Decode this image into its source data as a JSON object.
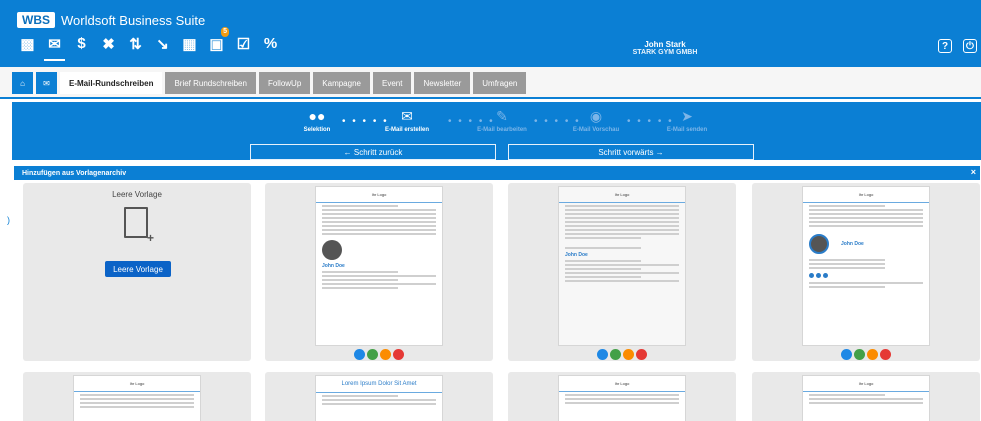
{
  "header": {
    "logo_box": "WBS",
    "logo_text": "Worldsoft Business Suite",
    "user_name": "John Stark",
    "user_company": "STARK GYM GMBH",
    "notification_count": "5",
    "toolbar_icons": [
      "contacts-icon",
      "mail-icon",
      "money-icon",
      "tools-icon",
      "finance-icon",
      "chart-icon",
      "calendar-icon",
      "notifications-icon",
      "tasks-icon",
      "percent-icon"
    ],
    "help_icon": "?",
    "power_icon": "⏻"
  },
  "tabs": {
    "items": [
      "E-Mail-Rundschreiben",
      "Brief Rundschreiben",
      "FollowUp",
      "Kampagne",
      "Event",
      "Newsletter",
      "Umfragen"
    ]
  },
  "wizard": {
    "steps": [
      "Selektion",
      "E-Mail erstellen",
      "E-Mail bearbeiten",
      "E-Mail Vorschau",
      "E-Mail senden"
    ],
    "back_label": "← Schritt zurück",
    "next_label": "Schritt vorwärts →"
  },
  "archive": {
    "title": "Hinzufügen aus Vorlagenarchiv",
    "close": "×",
    "blank_title": "Leere Vorlage",
    "blank_button": "Leere Vorlage",
    "row2_title": "Lorem Ipsum Dolor Sit Amet"
  },
  "templates": {
    "person_name": "John Doe",
    "colors": [
      "#1e88e5",
      "#43a047",
      "#fb8c00",
      "#e53935"
    ]
  }
}
